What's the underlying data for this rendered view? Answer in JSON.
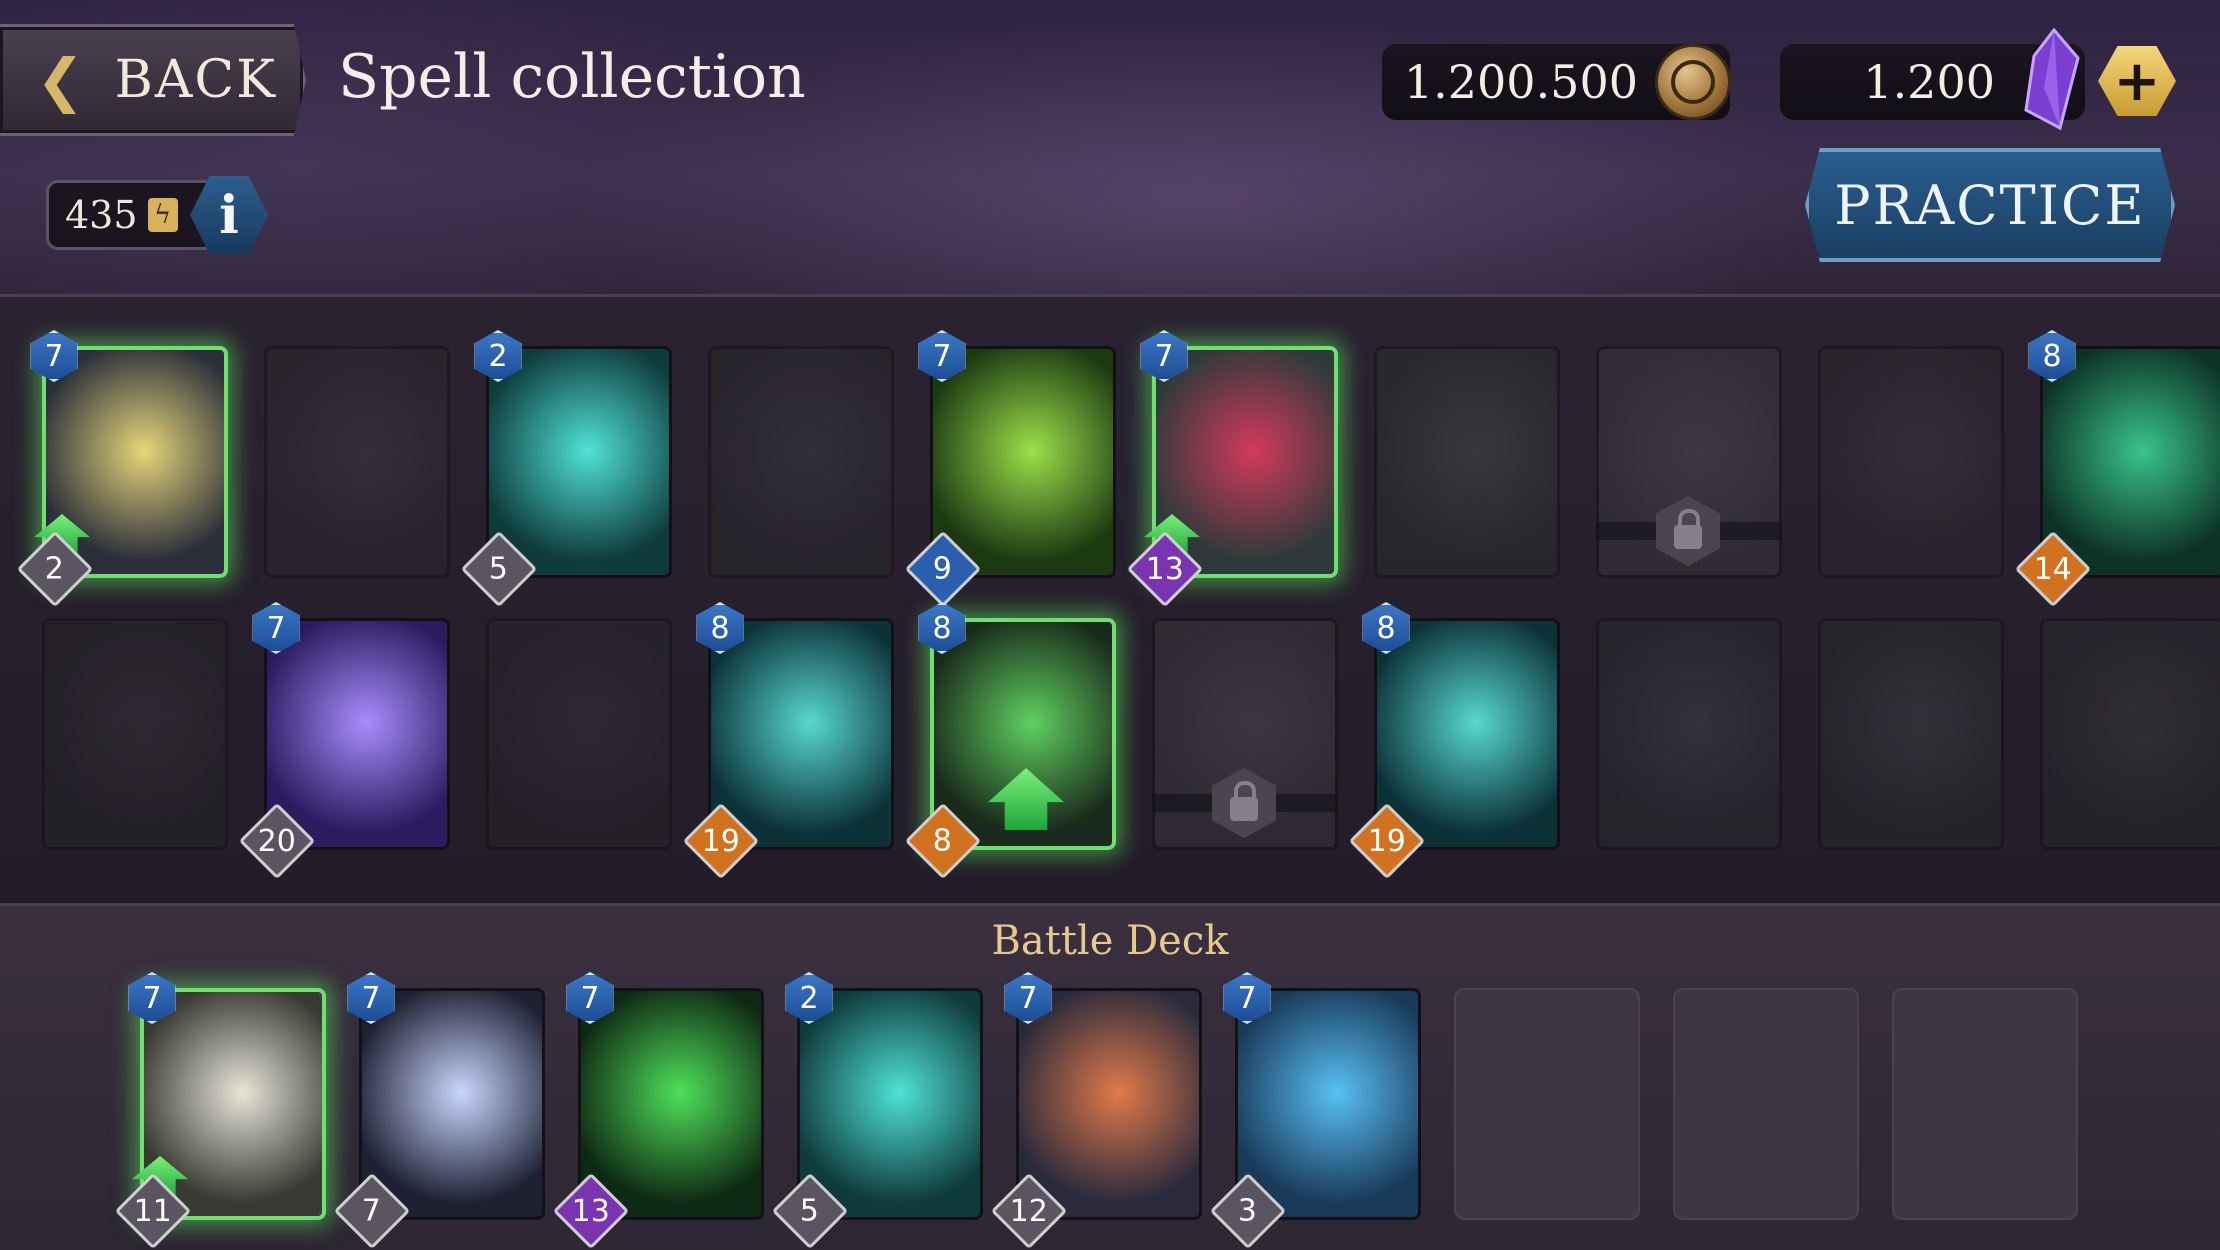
{
  "header": {
    "back_label": "BACK",
    "title": "Spell collection",
    "coins": "1.200.500",
    "gems": "1.200",
    "plus": "+",
    "practice_label": "PRACTICE",
    "energy": "435",
    "info": "i"
  },
  "collection": {
    "row1": [
      {
        "cost": "7",
        "level": "2",
        "level_color": "gray",
        "state": "selected",
        "upgrade": true,
        "art": [
          "#2c2f3a",
          "#e6d67a"
        ]
      },
      {
        "state": "locked",
        "art": [
          "#2f2530",
          "#4a3c4a"
        ]
      },
      {
        "cost": "2",
        "level": "5",
        "level_color": "gray",
        "state": "owned",
        "art": [
          "#0f3b3c",
          "#4fe2d5"
        ]
      },
      {
        "state": "locked",
        "art": [
          "#28262f",
          "#3c4150"
        ]
      },
      {
        "cost": "7",
        "level": "9",
        "level_color": "blue",
        "state": "owned",
        "art": [
          "#1c3a12",
          "#9be04a"
        ]
      },
      {
        "cost": "7",
        "level": "13",
        "level_color": "purple",
        "state": "selected",
        "upgrade": true,
        "art": [
          "#2e3a3a",
          "#d23a5c"
        ]
      },
      {
        "state": "locked",
        "art": [
          "#26302a",
          "#3e5a40"
        ]
      },
      {
        "state": "unavailable",
        "art": [
          "#3e3842",
          "#5a5360"
        ]
      },
      {
        "state": "locked",
        "art": [
          "#30252e",
          "#4d3a48"
        ]
      },
      {
        "cost": "8",
        "level": "14",
        "level_color": "orange",
        "state": "owned",
        "art": [
          "#0d3326",
          "#39c38b"
        ]
      }
    ],
    "row2": [
      {
        "state": "locked",
        "art": [
          "#262328",
          "#3d363c"
        ]
      },
      {
        "cost": "7",
        "level": "20",
        "level_color": "gray",
        "state": "owned",
        "art": [
          "#2a1c5e",
          "#a78dff"
        ]
      },
      {
        "state": "locked",
        "art": [
          "#29242b",
          "#3b3440"
        ]
      },
      {
        "cost": "8",
        "level": "19",
        "level_color": "orange",
        "state": "owned",
        "art": [
          "#0c3238",
          "#57d8cf"
        ]
      },
      {
        "cost": "8",
        "level": "8",
        "level_color": "orange",
        "state": "selected",
        "upgrade_big": true,
        "art": [
          "#1a2a1c",
          "#5fd05f"
        ]
      },
      {
        "state": "unavailable",
        "art": [
          "#3e3842",
          "#5a5360"
        ]
      },
      {
        "cost": "8",
        "level": "19",
        "level_color": "orange",
        "state": "owned",
        "art": [
          "#0c3238",
          "#57d8cf"
        ]
      },
      {
        "state": "locked",
        "art": [
          "#272b33",
          "#3f4a55"
        ]
      },
      {
        "state": "locked",
        "art": [
          "#262b2b",
          "#3c4a48"
        ]
      },
      {
        "state": "locked",
        "art": [
          "#28282a",
          "#404040"
        ]
      }
    ]
  },
  "deck": {
    "title": "Battle Deck",
    "cards": [
      {
        "cost": "7",
        "level": "11",
        "level_color": "gray",
        "state": "selected",
        "upgrade": true,
        "art": [
          "#3a3a34",
          "#e8e6d8"
        ]
      },
      {
        "cost": "7",
        "level": "7",
        "level_color": "gray",
        "state": "owned",
        "art": [
          "#1d2132",
          "#c9d6ff"
        ]
      },
      {
        "cost": "7",
        "level": "13",
        "level_color": "purple",
        "state": "owned",
        "art": [
          "#0f2a14",
          "#4fe05a"
        ]
      },
      {
        "cost": "2",
        "level": "5",
        "level_color": "gray",
        "state": "owned",
        "art": [
          "#0f3b3c",
          "#4fe2d5"
        ]
      },
      {
        "cost": "7",
        "level": "12",
        "level_color": "gray",
        "state": "owned",
        "art": [
          "#2a2a3c",
          "#e07a4a"
        ]
      },
      {
        "cost": "7",
        "level": "3",
        "level_color": "gray",
        "state": "owned",
        "art": [
          "#1a3a5a",
          "#58c0f5"
        ]
      }
    ],
    "empty_slots": 3
  }
}
